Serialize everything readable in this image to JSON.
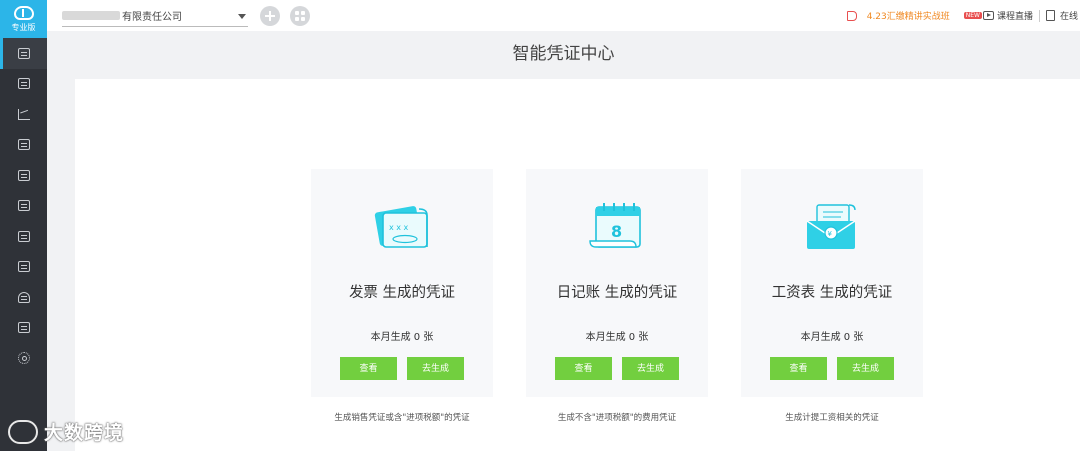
{
  "brand": {
    "label": "专业版",
    "icon": "cloud-upload-icon"
  },
  "sidebar": {
    "items": [
      {
        "name": "sidebar-item-voucher-center",
        "icon": "voucher-icon",
        "active": true
      },
      {
        "name": "sidebar-item-ledger",
        "icon": "ledger-icon"
      },
      {
        "name": "sidebar-item-reports",
        "icon": "chart-icon"
      },
      {
        "name": "sidebar-item-books",
        "icon": "book-icon"
      },
      {
        "name": "sidebar-item-calendar",
        "icon": "calendar-icon"
      },
      {
        "name": "sidebar-item-invoice",
        "icon": "invoice-icon"
      },
      {
        "name": "sidebar-item-inventory",
        "icon": "box-icon"
      },
      {
        "name": "sidebar-item-assets",
        "icon": "monitor-icon"
      },
      {
        "name": "sidebar-item-payroll",
        "icon": "person-icon"
      },
      {
        "name": "sidebar-item-tax",
        "icon": "tax-icon"
      },
      {
        "name": "sidebar-item-settings",
        "icon": "gear-icon"
      }
    ]
  },
  "header": {
    "company": "有限责任公司",
    "announcement": "4.23汇缴精讲实战班",
    "new_badge": "NEW",
    "live_label": "课程直播",
    "online_label": "在线"
  },
  "page": {
    "title": "智能凭证中心"
  },
  "cards": [
    {
      "title": "发票 生成的凭证",
      "count": "本月生成 0 张",
      "view": "查看",
      "generate": "去生成",
      "desc": "生成销售凭证或含\"进项税额\"的凭证",
      "icon": "invoice-ticket-icon"
    },
    {
      "title": "日记账 生成的凭证",
      "count": "本月生成 0 张",
      "view": "查看",
      "generate": "去生成",
      "desc": "生成不含\"进项税额\"的费用凭证",
      "icon": "journal-calendar-icon"
    },
    {
      "title": "工资表 生成的凭证",
      "count": "本月生成 0 张",
      "view": "查看",
      "generate": "去生成",
      "desc": "生成计提工资相关的凭证",
      "icon": "salary-envelope-icon"
    }
  ],
  "watermark": {
    "text": "大数跨境"
  },
  "colors": {
    "accent": "#2cb5e8",
    "button": "#72cf3f",
    "sidebar": "#2f3238",
    "announce": "#f08a24"
  }
}
